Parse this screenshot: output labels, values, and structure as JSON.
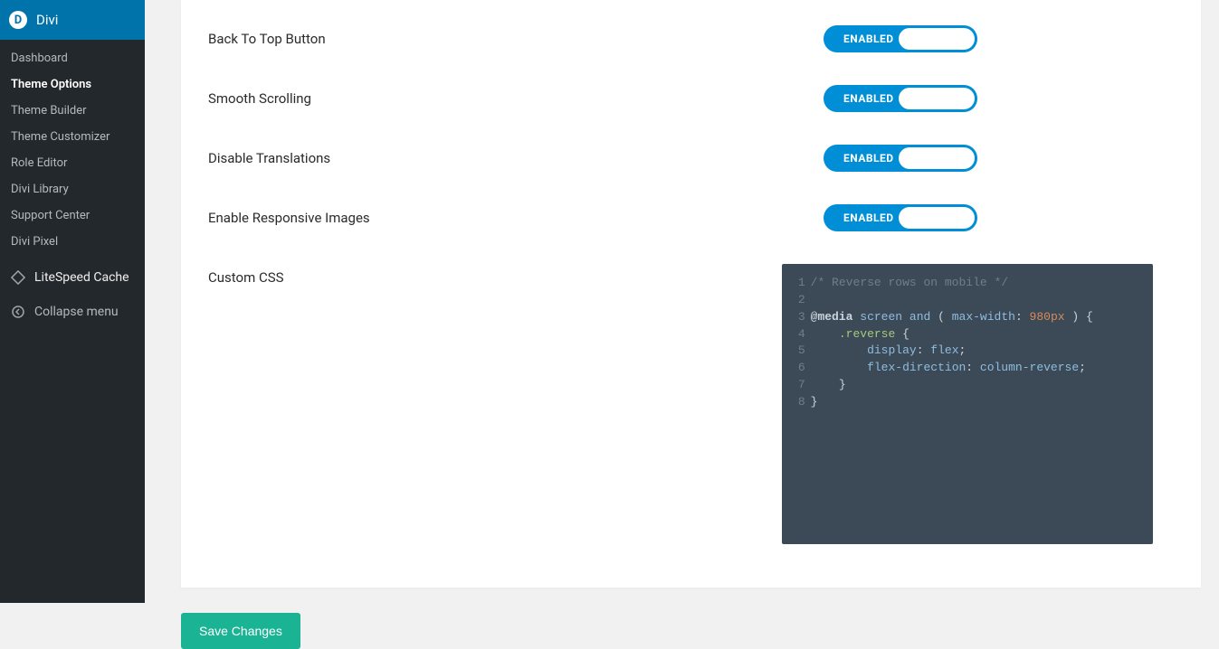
{
  "sidebar": {
    "top_label": "Divi",
    "top_icon": "D",
    "submenu": [
      {
        "label": "Dashboard",
        "current": false
      },
      {
        "label": "Theme Options",
        "current": true
      },
      {
        "label": "Theme Builder",
        "current": false
      },
      {
        "label": "Theme Customizer",
        "current": false
      },
      {
        "label": "Role Editor",
        "current": false
      },
      {
        "label": "Divi Library",
        "current": false
      },
      {
        "label": "Support Center",
        "current": false
      },
      {
        "label": "Divi Pixel",
        "current": false
      }
    ],
    "litespeed_label": "LiteSpeed Cache",
    "collapse_label": "Collapse menu"
  },
  "options": [
    {
      "label": "Back To Top Button",
      "state": "ENABLED"
    },
    {
      "label": "Smooth Scrolling",
      "state": "ENABLED"
    },
    {
      "label": "Disable Translations",
      "state": "ENABLED"
    },
    {
      "label": "Enable Responsive Images",
      "state": "ENABLED"
    }
  ],
  "css": {
    "label": "Custom CSS",
    "lines": [
      [
        {
          "t": "comment",
          "v": "/* Reverse rows on mobile */"
        }
      ],
      [],
      [
        {
          "t": "media",
          "v": "@media"
        },
        {
          "t": "punct",
          "v": " "
        },
        {
          "t": "mq",
          "v": "screen"
        },
        {
          "t": "punct",
          "v": " "
        },
        {
          "t": "mq",
          "v": "and"
        },
        {
          "t": "punct",
          "v": " ( "
        },
        {
          "t": "mq",
          "v": "max-width"
        },
        {
          "t": "punct",
          "v": ": "
        },
        {
          "t": "num",
          "v": "980px"
        },
        {
          "t": "punct",
          "v": " ) {"
        }
      ],
      [
        {
          "t": "punct",
          "v": "    "
        },
        {
          "t": "sel",
          "v": ".reverse"
        },
        {
          "t": "punct",
          "v": " {"
        }
      ],
      [
        {
          "t": "punct",
          "v": "        "
        },
        {
          "t": "prop",
          "v": "display"
        },
        {
          "t": "punct",
          "v": ": "
        },
        {
          "t": "val",
          "v": "flex"
        },
        {
          "t": "punct",
          "v": ";"
        }
      ],
      [
        {
          "t": "punct",
          "v": "        "
        },
        {
          "t": "prop",
          "v": "flex-direction"
        },
        {
          "t": "punct",
          "v": ": "
        },
        {
          "t": "val",
          "v": "column-reverse"
        },
        {
          "t": "punct",
          "v": ";"
        }
      ],
      [
        {
          "t": "punct",
          "v": "    }"
        }
      ],
      [
        {
          "t": "punct",
          "v": "}"
        }
      ]
    ]
  },
  "save_label": "Save Changes"
}
